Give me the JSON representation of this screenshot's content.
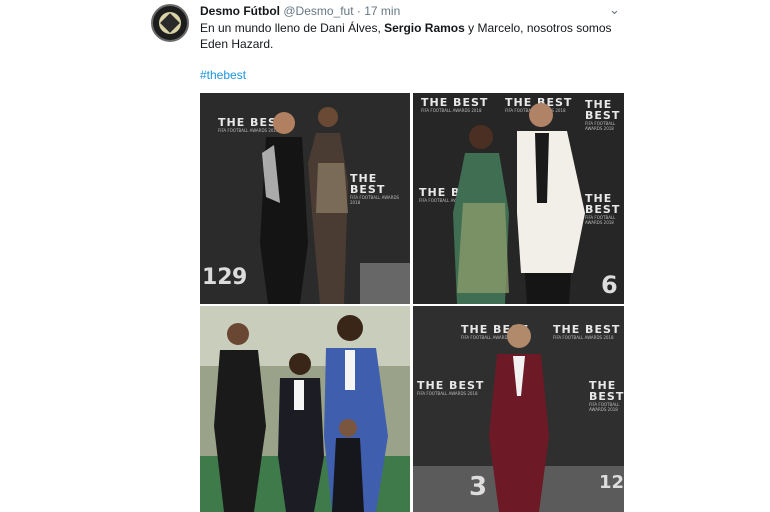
{
  "tweet": {
    "author_name": "Desmo Fútbol",
    "author_handle": "@Desmo_fut",
    "separator": "·",
    "time": "17 min",
    "text_part1": "En un mundo lleno de Dani Álves, ",
    "text_bold": "Sergio Ramos",
    "text_part2": " y Marcelo, nosotros somos Eden Hazard.",
    "hashtag": "#thebest"
  },
  "backdrop": {
    "logo_main": "THE BEST",
    "logo_sub": "FIFA FOOTBALL AWARDS 2018",
    "numbers": [
      "12",
      "9",
      "6",
      "3",
      "12"
    ]
  },
  "icons": {
    "menu": "chevron-down-icon",
    "avatar": "profile-avatar"
  }
}
